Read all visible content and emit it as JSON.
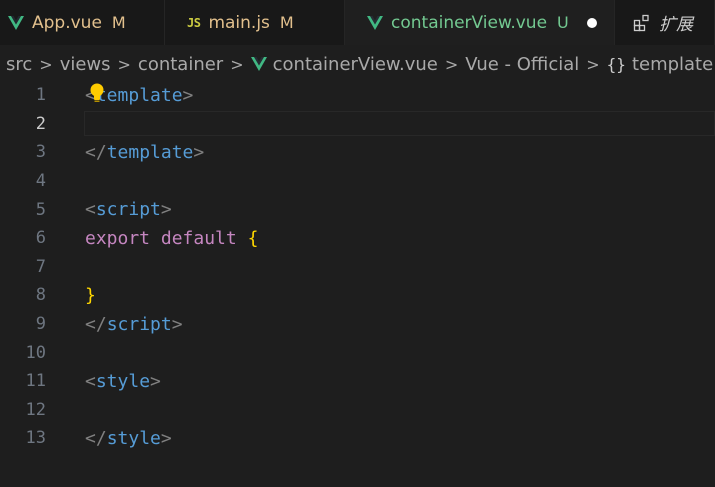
{
  "tabs": [
    {
      "label": "App.vue",
      "status": "M",
      "icon": "vue-icon"
    },
    {
      "label": "main.js",
      "status": "M",
      "icon": "js-icon",
      "badge": "JS"
    },
    {
      "label": "containerView.vue",
      "status": "U",
      "icon": "vue-icon",
      "modified_dot": true
    },
    {
      "label": "扩展",
      "icon": "extensions-icon"
    }
  ],
  "breadcrumb": {
    "items": [
      "src",
      "views",
      "container",
      "containerView.vue",
      "Vue - Official",
      "template"
    ],
    "symbol": "{}"
  },
  "editor": {
    "active_line": 2,
    "lines": [
      {
        "num": "1",
        "tokens": [
          {
            "t": "<",
            "c": "tag"
          },
          {
            "t": "template",
            "c": "tagname"
          },
          {
            "t": ">",
            "c": "tag"
          }
        ]
      },
      {
        "num": "2",
        "tokens": []
      },
      {
        "num": "3",
        "tokens": [
          {
            "t": "</",
            "c": "tag"
          },
          {
            "t": "template",
            "c": "tagname"
          },
          {
            "t": ">",
            "c": "tag"
          }
        ]
      },
      {
        "num": "4",
        "tokens": []
      },
      {
        "num": "5",
        "tokens": [
          {
            "t": "<",
            "c": "tag"
          },
          {
            "t": "script",
            "c": "tagname"
          },
          {
            "t": ">",
            "c": "tag"
          }
        ]
      },
      {
        "num": "6",
        "tokens": [
          {
            "t": "export",
            "c": "kw"
          },
          {
            "t": " ",
            "c": ""
          },
          {
            "t": "default",
            "c": "kw"
          },
          {
            "t": " ",
            "c": ""
          },
          {
            "t": "{",
            "c": "brace"
          }
        ]
      },
      {
        "num": "7",
        "tokens": []
      },
      {
        "num": "8",
        "tokens": [
          {
            "t": "}",
            "c": "brace"
          }
        ]
      },
      {
        "num": "9",
        "tokens": [
          {
            "t": "</",
            "c": "tag"
          },
          {
            "t": "script",
            "c": "tagname"
          },
          {
            "t": ">",
            "c": "tag"
          }
        ]
      },
      {
        "num": "10",
        "tokens": []
      },
      {
        "num": "11",
        "tokens": [
          {
            "t": "<",
            "c": "tag"
          },
          {
            "t": "style",
            "c": "tagname"
          },
          {
            "t": ">",
            "c": "tag"
          }
        ]
      },
      {
        "num": "12",
        "tokens": []
      },
      {
        "num": "13",
        "tokens": [
          {
            "t": "</",
            "c": "tag"
          },
          {
            "t": "style",
            "c": "tagname"
          },
          {
            "t": ">",
            "c": "tag"
          }
        ]
      }
    ]
  },
  "colors": {
    "vue_green": "#41b883",
    "modified": "#e2c08d",
    "untracked": "#73c991",
    "lightbulb": "#ffcc00"
  }
}
